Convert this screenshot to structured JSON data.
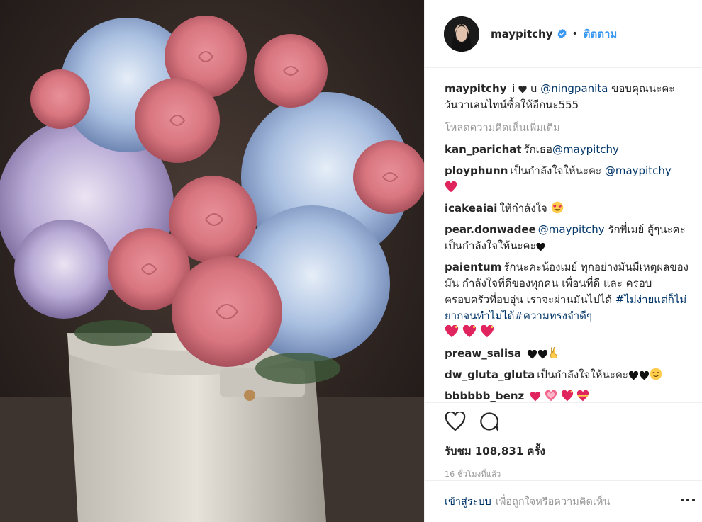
{
  "header": {
    "username": "maypitchy",
    "dot": "•",
    "follow_label": "ติดตาม"
  },
  "caption": {
    "user": "maypitchy",
    "text_1": " i ",
    "text_2": " u ",
    "mention": "@ningpanita",
    "text_3": " ขอบคุณนะคะ วันวาเลนไทน์ซื้อให้อีกนะ555"
  },
  "load_more": "โหลดความคิดเห็นเพิ่มเติม",
  "comments": [
    {
      "user": "kan_parichat",
      "text": "รักเธอ",
      "mention": "@maypitchy"
    },
    {
      "user": "ployphunn",
      "text": "เป็นกำลังใจให้นะคะ ",
      "mention": "@maypitchy"
    },
    {
      "user": "icakeaiai",
      "text": "ให้กำลังใจ "
    },
    {
      "user": "pear.donwadee",
      "mention": "@maypitchy",
      "text": " รักพี่เมย์ สู้ๆนะคะเป็นกำลังใจให้นะคะ"
    },
    {
      "user": "paientum",
      "text": "รักนะคะน้องเมย์ ทุกอย่างมันมีเหตุผลของมัน กำลังใจที่ดีของทุกคน เพื่อนที่ดี และ ครอบครอบครัวที่อบอุ่น เราจะผ่านมันไปได้ ",
      "tag": "#ไม่ง่ายแต่ก็ไม่ยากจนทำไม่ได้#ความทรงจำดีๆ"
    },
    {
      "user": "preaw_salisa",
      "text": ""
    },
    {
      "user": "dw_gluta_gluta",
      "text": "เป็นกำลังใจให้นะคะ"
    },
    {
      "user": "bbbbbb_benz",
      "text": ""
    }
  ],
  "actions": {
    "views": "รับชม 108,831 ครั้ง",
    "time": "16 ชั่วโมงที่แล้ว"
  },
  "login_bar": {
    "link": "เข้าสู่ระบบ",
    "rest": "เพื่อถูกใจหรือความคิดเห็น"
  },
  "icons": {
    "heart": "heart-icon",
    "comment": "comment-icon",
    "more": "more-icon",
    "verified": "verified-badge-icon"
  },
  "colors": {
    "link_blue": "#3897f0",
    "mention_blue": "#003569",
    "muted": "#999999",
    "text": "#262626",
    "emoji_red": "#e0245e"
  }
}
